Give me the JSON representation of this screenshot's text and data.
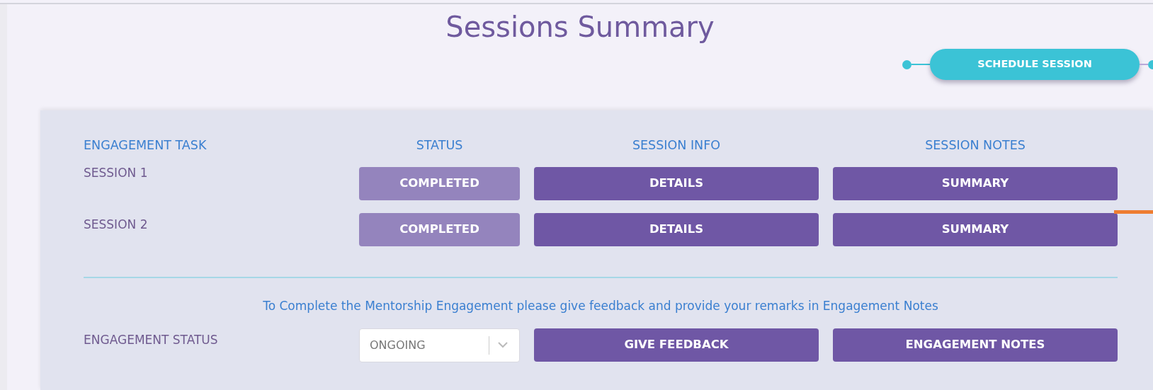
{
  "title": "Sessions Summary",
  "stepper": {
    "step_label": "SCHEDULE SESSION"
  },
  "table": {
    "columns": [
      "ENGAGEMENT TASK",
      "STATUS",
      "SESSION INFO",
      "SESSION NOTES"
    ],
    "rows": [
      {
        "task": "SESSION 1",
        "status": {
          "label": "COMPLETED",
          "kind": "completed"
        },
        "info": "DETAILS",
        "notes": "SUMMARY"
      },
      {
        "task": "SESSION 2",
        "status": {
          "label": "COMPLETED",
          "kind": "completed"
        },
        "info": "DETAILS",
        "notes": "SUMMARY"
      }
    ]
  },
  "note": "To Complete the Mentorship Engagement please give feedback and provide your remarks in Engagement Notes",
  "engagement": {
    "label": "ENGAGEMENT STATUS",
    "select_value": "ONGOING",
    "feedback_button": "GIVE FEEDBACK",
    "notes_button": "ENGAGEMENT NOTES"
  }
}
